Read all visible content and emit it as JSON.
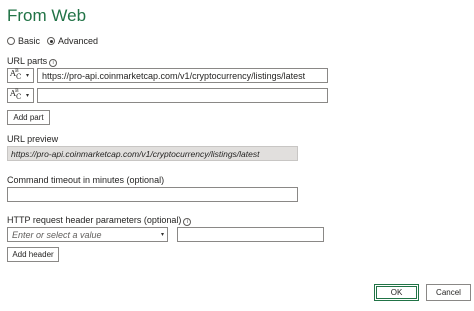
{
  "dialog": {
    "title": "From Web"
  },
  "mode": {
    "options": [
      {
        "label": "Basic",
        "selected": false
      },
      {
        "label": "Advanced",
        "selected": true
      }
    ]
  },
  "url_parts": {
    "label": "URL parts",
    "info_icon": "i",
    "type_glyph": {
      "a": "A",
      "b": "B",
      "c": "C"
    },
    "dropdown_glyph": "▾",
    "parts": [
      {
        "value": "https://pro-api.coinmarketcap.com/v1/cryptocurrency/listings/latest"
      },
      {
        "value": ""
      }
    ],
    "add_part_label": "Add part"
  },
  "url_preview": {
    "label": "URL preview",
    "value": "https://pro-api.coinmarketcap.com/v1/cryptocurrency/listings/latest"
  },
  "timeout": {
    "label": "Command timeout in minutes (optional)",
    "value": ""
  },
  "headers": {
    "label": "HTTP request header parameters (optional)",
    "info_icon": "i",
    "name_placeholder": "Enter or select a value",
    "dropdown_glyph": "▾",
    "value": "",
    "add_header_label": "Add header"
  },
  "footer": {
    "ok_label": "OK",
    "cancel_label": "Cancel"
  },
  "colors": {
    "accent": "#217346",
    "border": "#8a8886",
    "preview_bg": "#e1dfdd"
  }
}
